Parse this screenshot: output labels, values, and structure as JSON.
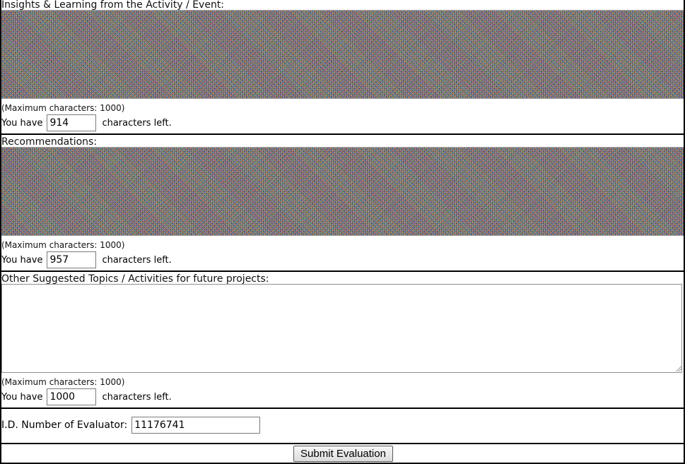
{
  "fields": [
    {
      "label": "Insights & Learning from the Activity / Event:",
      "max_note": "(Maximum characters: 1000)",
      "left_prefix": "You have",
      "left_value": "914",
      "left_suffix": "characters left."
    },
    {
      "label": "Recommendations:",
      "max_note": "(Maximum characters: 1000)",
      "left_prefix": "You have",
      "left_value": "957",
      "left_suffix": "characters left."
    },
    {
      "label": "Other Suggested Topics / Activities for future projects:",
      "max_note": "(Maximum characters: 1000)",
      "left_prefix": "You have",
      "left_value": "1000",
      "left_suffix": "characters left."
    }
  ],
  "evaluator": {
    "label": "I.D. Number of Evaluator:",
    "value": "11176741"
  },
  "submit_label": "Submit Evaluation"
}
